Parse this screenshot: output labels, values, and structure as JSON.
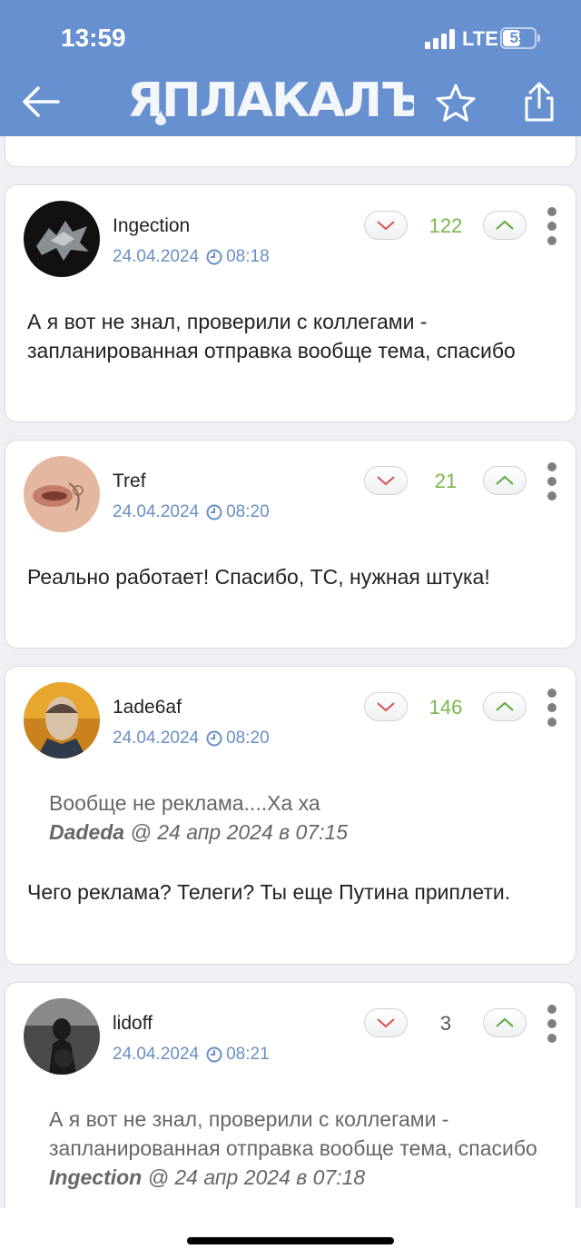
{
  "status_bar": {
    "time": "13:59",
    "network": "LTE",
    "battery": "55",
    "battery_fraction": 0.55
  },
  "header": {
    "logo_text": "ЯПЛАКАЛЪ",
    "back_icon": "arrow-left-icon",
    "favorite_icon": "star-icon",
    "share_icon": "share-icon"
  },
  "colors": {
    "header_bg": "#6690cf",
    "score_positive": "#7cb749",
    "meta_blue": "#6a8fc4"
  },
  "comments": [
    {
      "username": "Ingection",
      "date": "24.04.2024",
      "time": "08:18",
      "score": "122",
      "text": "А я вот не знал, проверили с коллегами - запланированная отправка вообще тема, спасибо"
    },
    {
      "username": "Tref",
      "date": "24.04.2024",
      "time": "08:20",
      "score": "21",
      "text": "Реально работает! Спасибо, ТС, нужная штука!"
    },
    {
      "username": "1ade6af",
      "date": "24.04.2024",
      "time": "08:20",
      "score": "146",
      "quote": {
        "text": "Вообще не реклама....Ха ха",
        "author": "Dadeda",
        "meta": " @ 24 апр 2024 в 07:15"
      },
      "text": "Чего реклама? Телеги? Ты еще Путина приплети."
    },
    {
      "username": "lidoff",
      "date": "24.04.2024",
      "time": "08:21",
      "score": "3",
      "quote": {
        "text": "А я вот не знал, проверили с коллегами - запланированная отправка вообще тема, спасибо",
        "author": "Ingection",
        "meta": " @ 24 апр 2024 в 07:18"
      }
    }
  ]
}
